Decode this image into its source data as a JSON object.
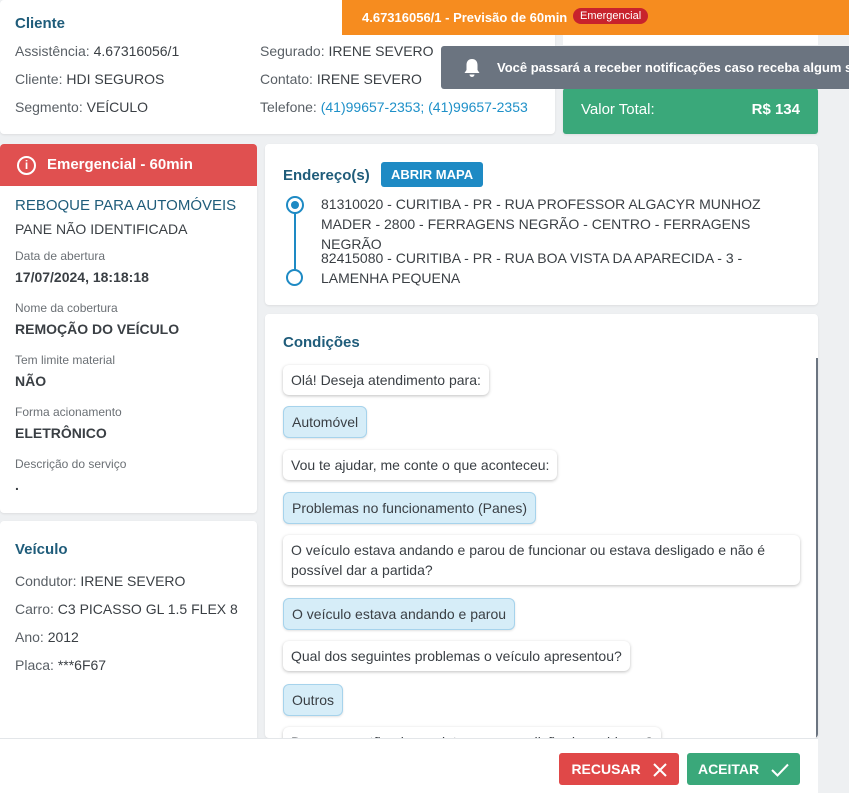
{
  "cliente": {
    "title": "Cliente",
    "assistencia_label": "Assistência: ",
    "assistencia_value": "4.67316056/1",
    "cliente_label": "Cliente: ",
    "cliente_value": "HDI SEGUROS",
    "segmento_label": "Segmento: ",
    "segmento_value": "VEÍCULO",
    "segurado_label": "Segurado: ",
    "segurado_value": "IRENE SEVERO",
    "contato_label": "Contato: ",
    "contato_value": "IRENE SEVERO",
    "telefone_label": "Telefone: ",
    "telefone_value": "(41)99657-2353; (41)99657-2353"
  },
  "header_bar": {
    "text": "4.67316056/1 - Previsão de 60min",
    "badge": "Emergencial",
    "color": "#f68c1f"
  },
  "notification": {
    "icon": "bell-icon",
    "text": "Você passará a receber notificações caso receba algum serviço"
  },
  "total": {
    "label": "Valor Total:",
    "value": "R$ 134"
  },
  "emergencia": {
    "label": "Emergencial - 60min",
    "icon": "info-icon",
    "color": "#e05050"
  },
  "servico": {
    "title": "REBOQUE PARA AUTOMÓVEIS",
    "subtitle": "PANE NÃO IDENTIFICADA",
    "data_label": "Data de abertura",
    "data_value": "17/07/2024, 18:18:18",
    "cobertura_label": "Nome da cobertura",
    "cobertura_value": "REMOÇÃO DO VEÍCULO",
    "limite_label": "Tem limite material",
    "limite_value": "NÃO",
    "acionamento_label": "Forma acionamento",
    "acionamento_value": "ELETRÔNICO",
    "descricao_label": "Descrição do serviço",
    "descricao_value": "."
  },
  "veiculo": {
    "title": "Veículo",
    "condutor_label": "Condutor: ",
    "condutor_value": "IRENE SEVERO",
    "carro_label": "Carro: ",
    "carro_value": "C3 PICASSO GL 1.5 FLEX 8",
    "ano_label": "Ano: ",
    "ano_value": "2012",
    "placa_label": "Placa: ",
    "placa_value": "***6F67"
  },
  "enderecos": {
    "title": "Endereço(s)",
    "map_button": "ABRIR MAPA",
    "origem": "81310020 - CURITIBA - PR - RUA PROFESSOR ALGACYR MUNHOZ MADER - 2800 - FERRAGENS NEGRÃO - CENTRO - FERRAGENS NEGRÃO",
    "destino": "82415080 - CURITIBA - PR - RUA BOA VISTA DA APARECIDA - 3 - LAMENHA PEQUENA"
  },
  "condicoes": {
    "title": "Condições",
    "messages": [
      {
        "type": "q",
        "text": "Olá! Deseja atendimento para:"
      },
      {
        "type": "a",
        "text": "Automóvel"
      },
      {
        "type": "q",
        "text": "Vou te ajudar, me conte o que aconteceu:"
      },
      {
        "type": "a",
        "text": "Problemas no funcionamento (Panes)"
      },
      {
        "type": "q",
        "text": "O veículo estava andando e parou de funcionar ou estava desligado e não é possível dar a partida?"
      },
      {
        "type": "a",
        "text": "O veículo estava andando e parou"
      },
      {
        "type": "q",
        "text": "Qual dos seguintes problemas o veículo apresentou?"
      },
      {
        "type": "a",
        "text": "Outros"
      },
      {
        "type": "q",
        "text": "Descreva então algum sintoma ou condição do problema?"
      }
    ]
  },
  "actions": {
    "recusar": "RECUSAR",
    "aceitar": "ACEITAR"
  }
}
